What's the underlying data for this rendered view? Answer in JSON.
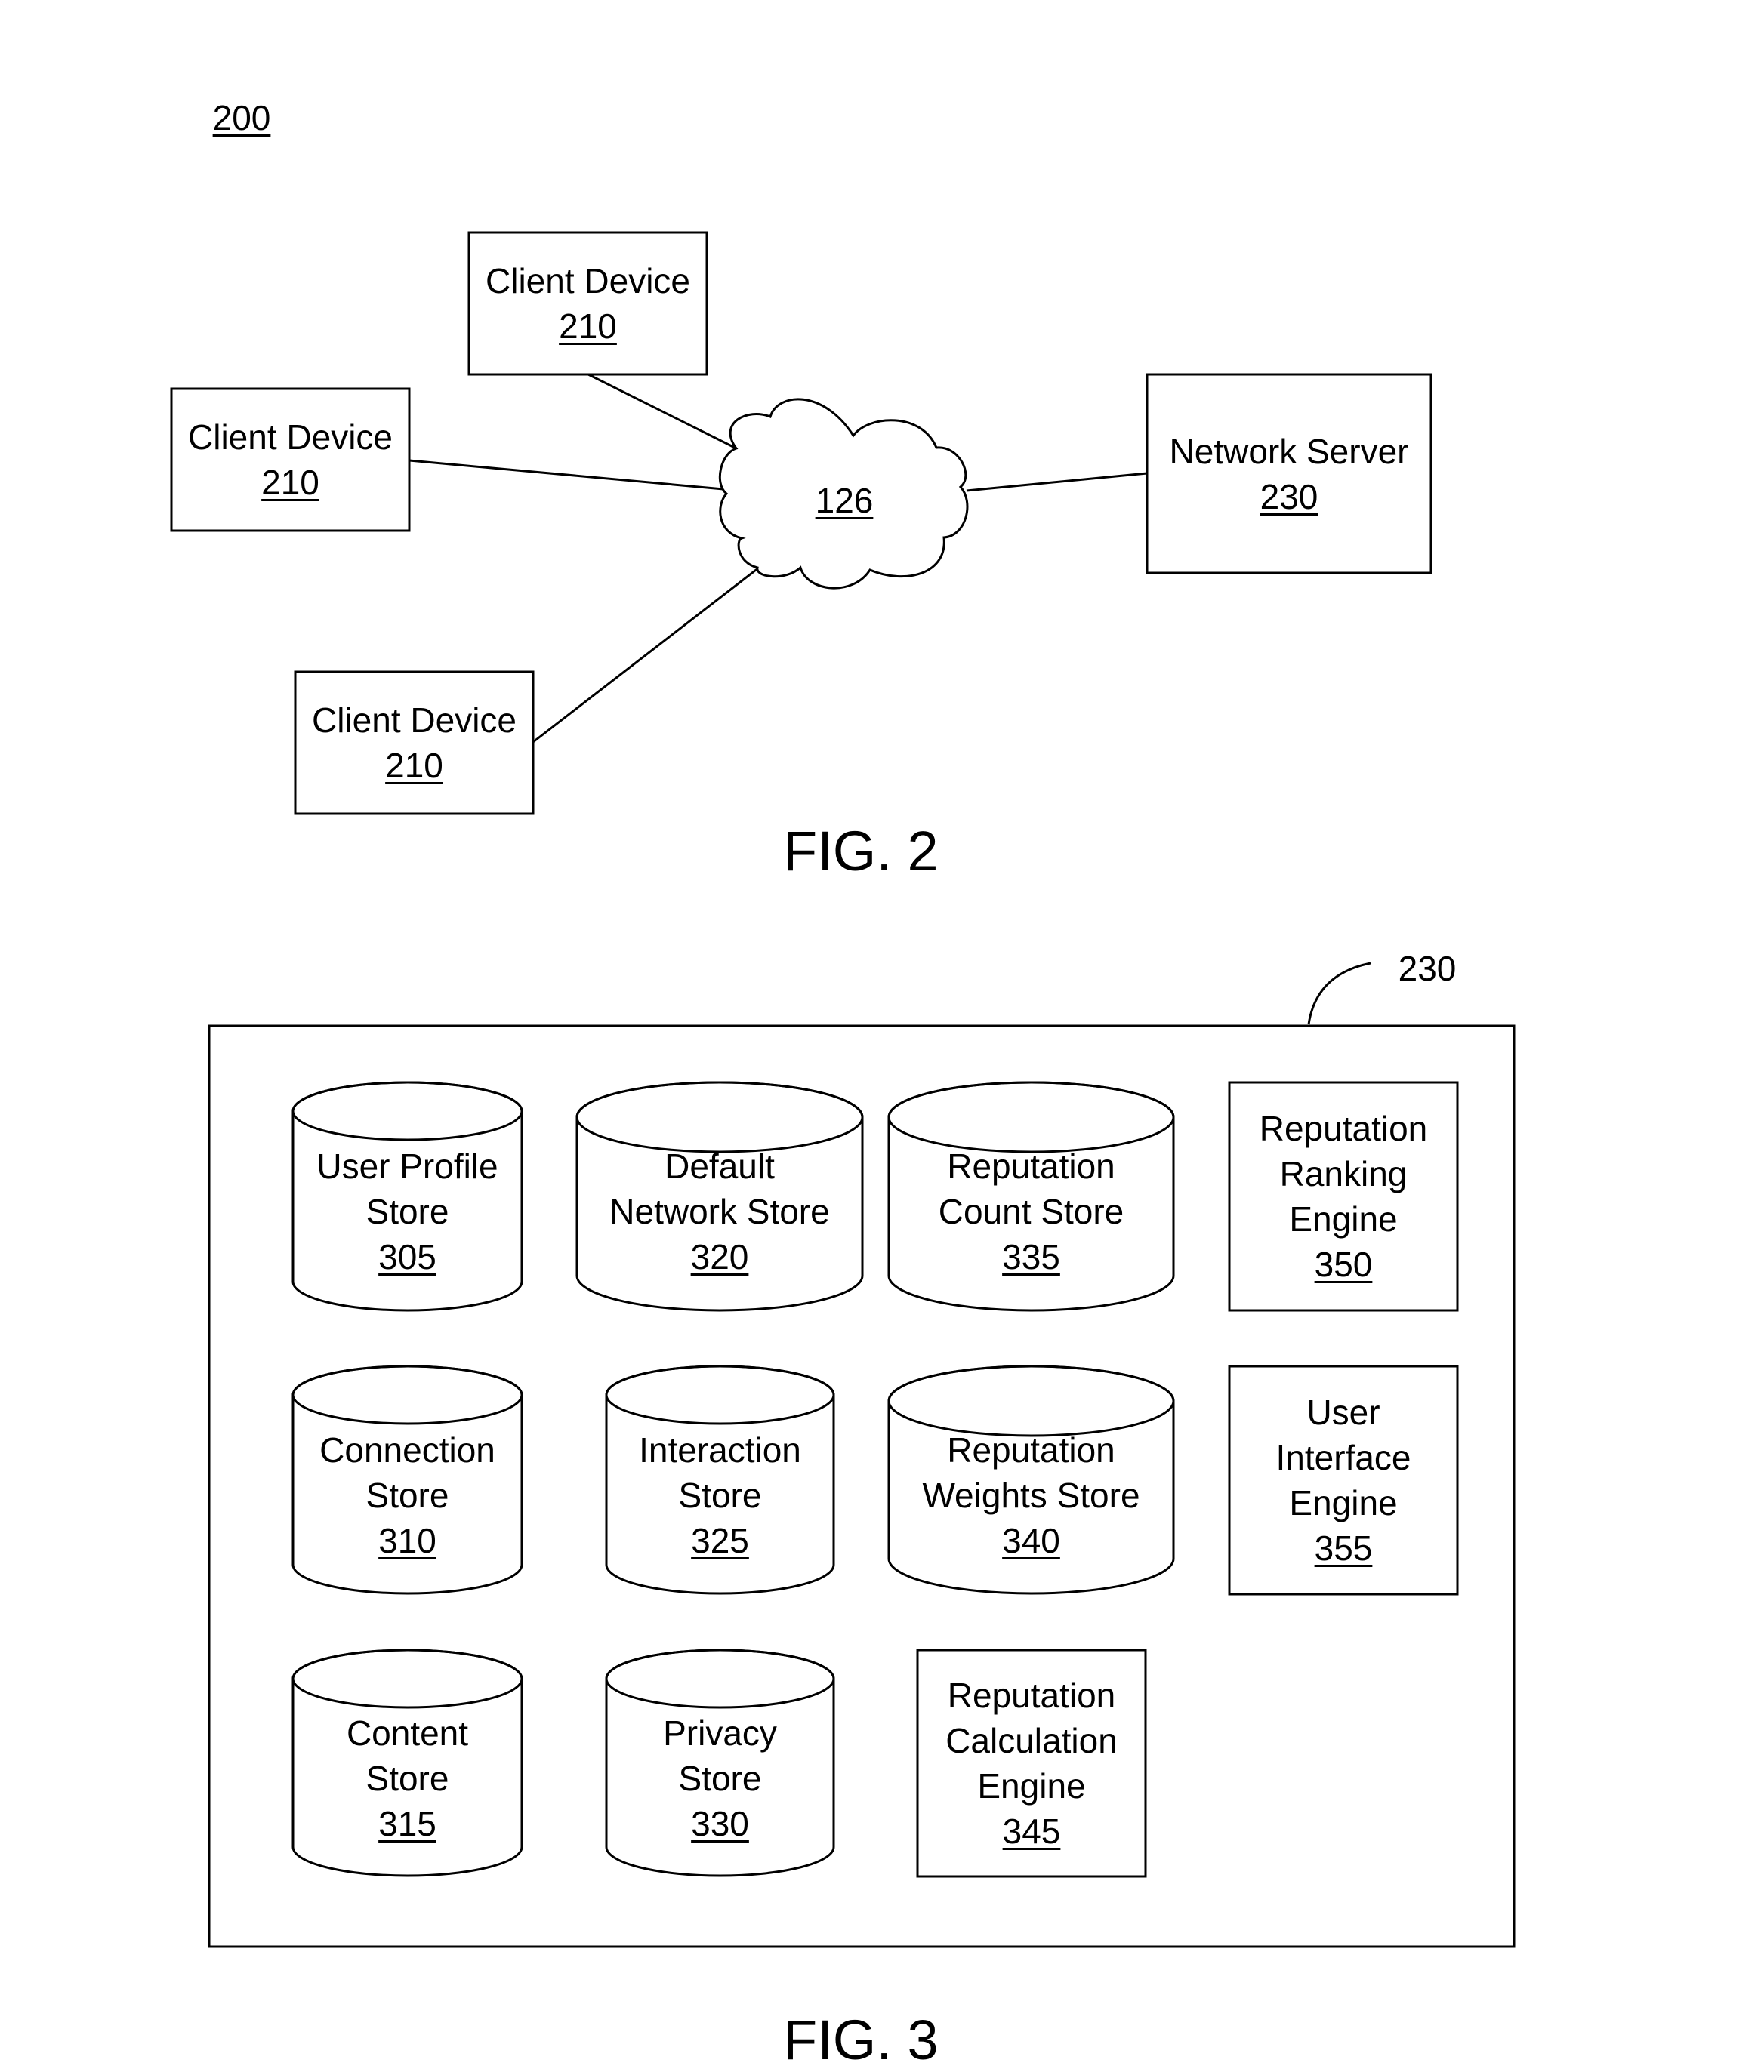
{
  "fig2": {
    "ref": "200",
    "caption": "FIG. 2",
    "network_ref": "126",
    "clients": [
      {
        "label": "Client Device",
        "ref": "210"
      },
      {
        "label": "Client Device",
        "ref": "210"
      },
      {
        "label": "Client Device",
        "ref": "210"
      }
    ],
    "server": {
      "label": "Network Server",
      "ref": "230"
    }
  },
  "fig3": {
    "ref": "230",
    "caption": "FIG. 3",
    "components": [
      {
        "lines": [
          "User Profile",
          "Store"
        ],
        "ref": "305",
        "kind": "store"
      },
      {
        "lines": [
          "Default",
          "Network Store"
        ],
        "ref": "320",
        "kind": "store"
      },
      {
        "lines": [
          "Reputation",
          "Count Store"
        ],
        "ref": "335",
        "kind": "store"
      },
      {
        "lines": [
          "Reputation",
          "Ranking",
          "Engine"
        ],
        "ref": "350",
        "kind": "engine"
      },
      {
        "lines": [
          "Connection",
          "Store"
        ],
        "ref": "310",
        "kind": "store"
      },
      {
        "lines": [
          "Interaction",
          "Store"
        ],
        "ref": "325",
        "kind": "store"
      },
      {
        "lines": [
          "Reputation",
          "Weights Store"
        ],
        "ref": "340",
        "kind": "store"
      },
      {
        "lines": [
          "User",
          "Interface",
          "Engine"
        ],
        "ref": "355",
        "kind": "engine"
      },
      {
        "lines": [
          "Content",
          "Store"
        ],
        "ref": "315",
        "kind": "store"
      },
      {
        "lines": [
          "Privacy",
          "Store"
        ],
        "ref": "330",
        "kind": "store"
      },
      {
        "lines": [
          "Reputation",
          "Calculation",
          "Engine"
        ],
        "ref": "345",
        "kind": "engine"
      }
    ]
  }
}
